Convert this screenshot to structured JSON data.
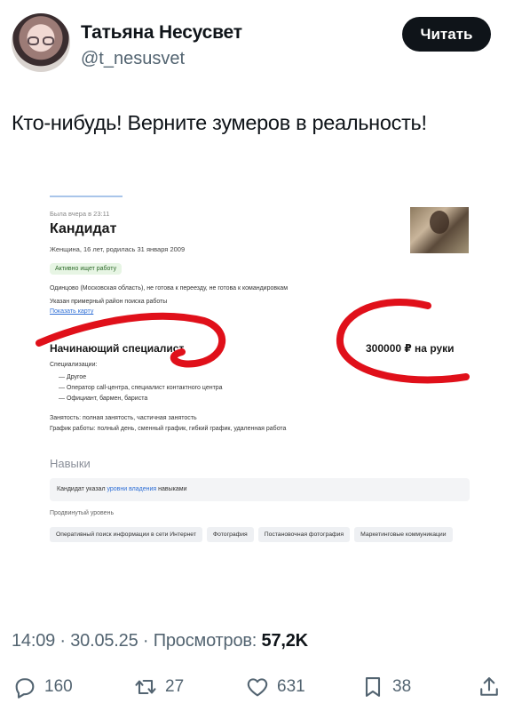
{
  "author": {
    "name": "Татьяна Несусвет",
    "handle": "@t_nesusvet",
    "follow_label": "Читать"
  },
  "tweet": {
    "text": "Кто-нибудь! Верните зумеров в реальность!"
  },
  "resume": {
    "was_online": "Была вчера в 23:11",
    "title": "Кандидат",
    "meta": "Женщина, 16 лет, родилась 31 января 2009",
    "status_badge": "Активно ищет работу",
    "location": "Одинцово (Московская область), не готова к переезду, не готова к командировкам",
    "region_note": "Указан примерный район поиска работы",
    "show_map": "Показать карту",
    "position": "Начинающий специалист",
    "salary": "300000 ₽ на руки",
    "specializations_label": "Специализации:",
    "specializations": [
      "Другое",
      "Оператор call-центра, специалист контактного центра",
      "Официант, бармен, бариста"
    ],
    "employment": "Занятость: полная занятость, частичная занятость",
    "schedule": "График работы: полный день, сменный график, гибкий график, удаленная работа",
    "skills_heading": "Навыки",
    "skills_note_before": "Кандидат указал ",
    "skills_note_link": "уровни владения",
    "skills_note_after": " навыками",
    "level_label": "Продвинутый уровень",
    "skill_tags": [
      "Оперативный поиск информации в сети Интернет",
      "Фотография",
      "Постановочная фотография",
      "Маркетинговые коммуникации"
    ]
  },
  "footer": {
    "time": "14:09",
    "date": "30.05.25",
    "views_label": "Просмотров:",
    "views_count": "57,2K",
    "separator": "·"
  },
  "actions": {
    "replies": "160",
    "reposts": "27",
    "likes": "631",
    "bookmarks": "38"
  },
  "colors": {
    "accent_dark": "#0f1419",
    "secondary_text": "#536471",
    "annotation_red": "#e0101a",
    "link_blue": "#2f6fd6"
  }
}
